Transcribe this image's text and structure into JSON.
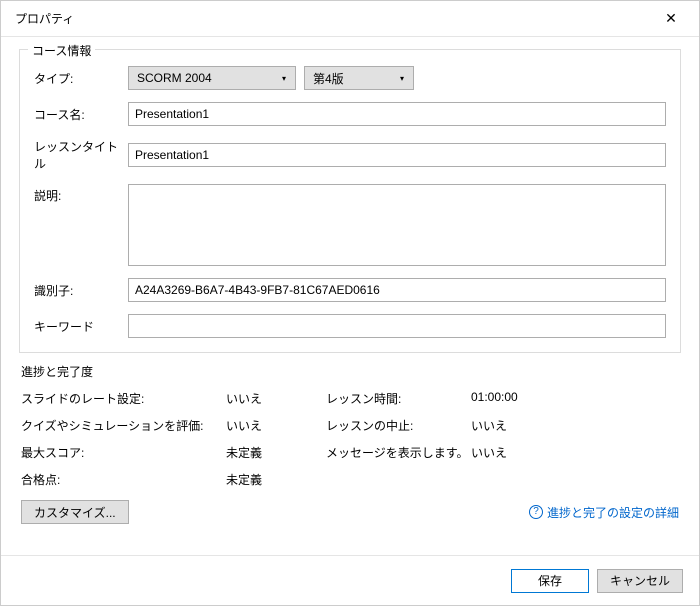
{
  "window": {
    "title": "プロパティ"
  },
  "course_info": {
    "legend": "コース情報",
    "type_label": "タイプ:",
    "type_value": "SCORM 2004",
    "version_value": "第4版",
    "course_name_label": "コース名:",
    "course_name_value": "Presentation1",
    "lesson_title_label": "レッスンタイトル",
    "lesson_title_value": "Presentation1",
    "description_label": "説明:",
    "description_value": "",
    "identifier_label": "識別子:",
    "identifier_value": "A24A3269-B6A7-4B43-9FB7-81C67AED0616",
    "keyword_label": "キーワード",
    "keyword_value": ""
  },
  "progress": {
    "legend": "進捗と完了度",
    "slide_rate_label": "スライドのレート設定:",
    "slide_rate_value": "いいえ",
    "lesson_time_label": "レッスン時間:",
    "lesson_time_value": "01:00:00",
    "quiz_eval_label": "クイズやシミュレーションを評価:",
    "quiz_eval_value": "いいえ",
    "lesson_abort_label": "レッスンの中止:",
    "lesson_abort_value": "いいえ",
    "max_score_label": "最大スコア:",
    "max_score_value": "未定義",
    "message_label": "メッセージを表示します。",
    "message_value": "いいえ",
    "pass_score_label": "合格点:",
    "pass_score_value": "未定義",
    "customize_button": "カスタマイズ...",
    "details_link": "進捗と完了の設定の詳細"
  },
  "buttons": {
    "save": "保存",
    "cancel": "キャンセル"
  }
}
